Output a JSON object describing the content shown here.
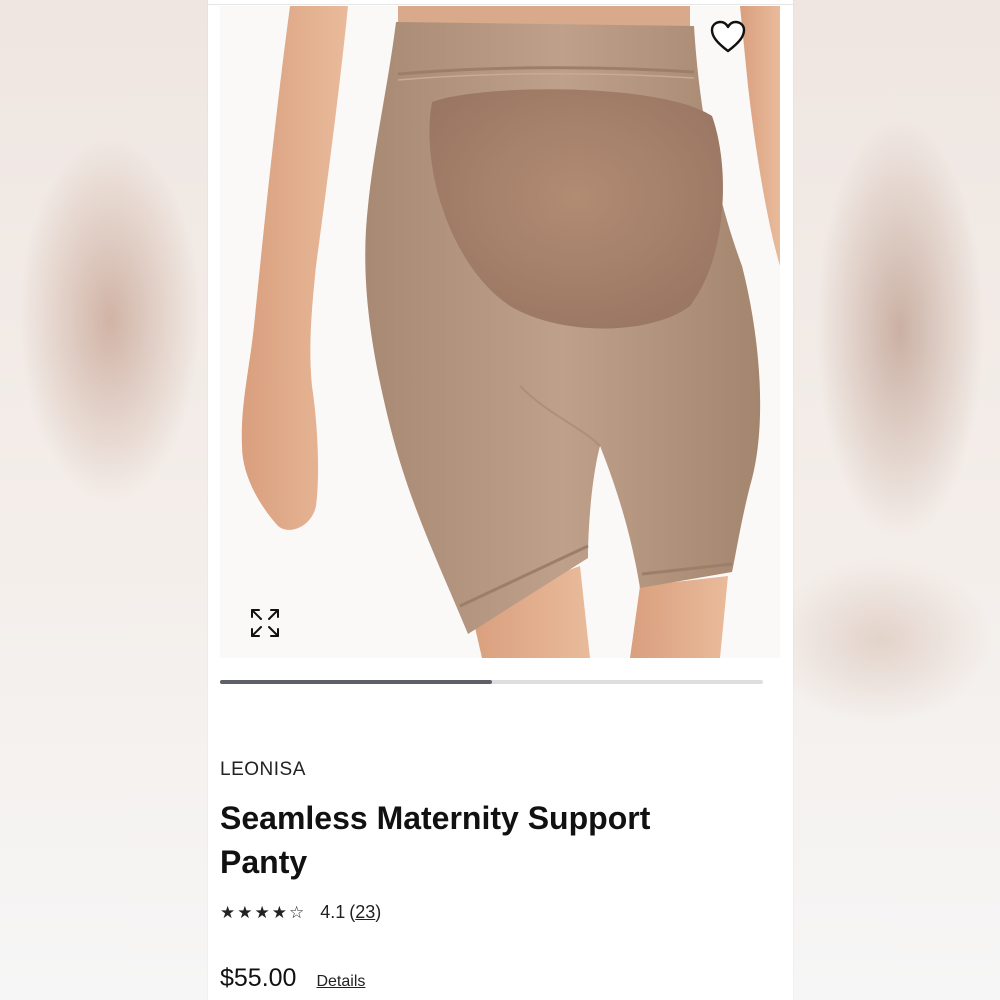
{
  "product": {
    "brand": "LEONISA",
    "name": "Seamless Maternity Support Panty",
    "rating": {
      "stars_display": "★★★★☆",
      "value_text": "4.1",
      "value": 4.1,
      "review_count": "23",
      "open_paren": "(",
      "close_paren": ")"
    },
    "price": "$55.00",
    "details_label": "Details"
  },
  "gallery": {
    "progress_fraction": 0.5,
    "favorite_icon": "heart-outline-icon",
    "expand_icon": "expand-arrows-icon"
  },
  "colors": {
    "garment": "#b89a83",
    "skin": "#e4b08f",
    "progress_fill": "#5e6068",
    "progress_track": "#dedede"
  }
}
